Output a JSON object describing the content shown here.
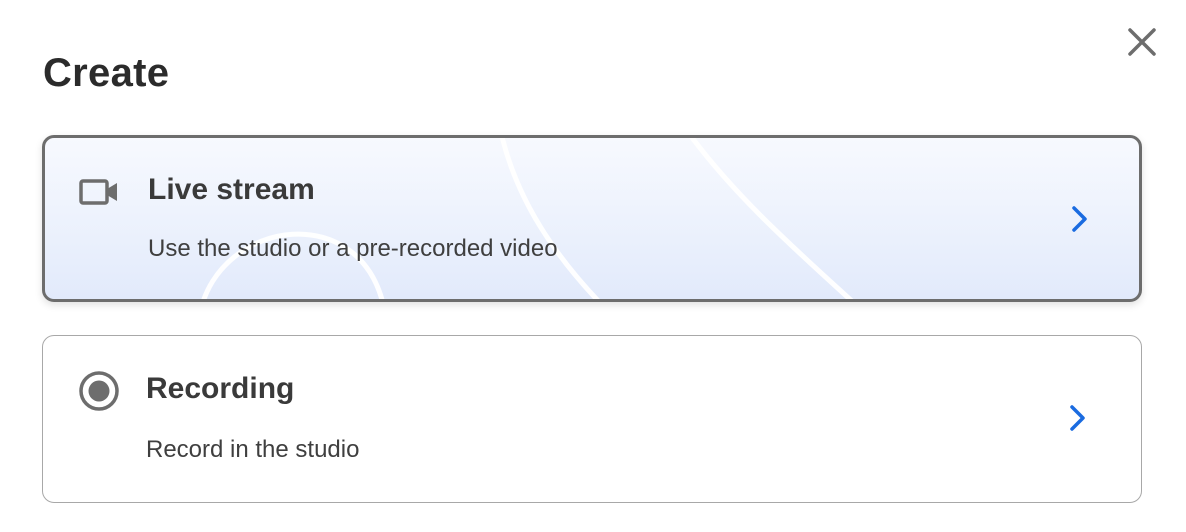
{
  "dialog": {
    "title": "Create",
    "close_icon": "close-icon"
  },
  "options": [
    {
      "icon": "video-camera-icon",
      "title": "Live stream",
      "description": "Use the studio or a pre-recorded video",
      "chevron_icon": "chevron-right-icon",
      "selected": true
    },
    {
      "icon": "record-icon",
      "title": "Recording",
      "description": "Record in the studio",
      "chevron_icon": "chevron-right-icon",
      "selected": false
    }
  ],
  "colors": {
    "title_text": "#2b2b2b",
    "accent": "#1a6be0",
    "icon_gray": "#6d6d6d",
    "selected_border": "#6d6d6d",
    "card_border": "#a8a8a8",
    "selected_gradient_end": "#e2eafb"
  }
}
